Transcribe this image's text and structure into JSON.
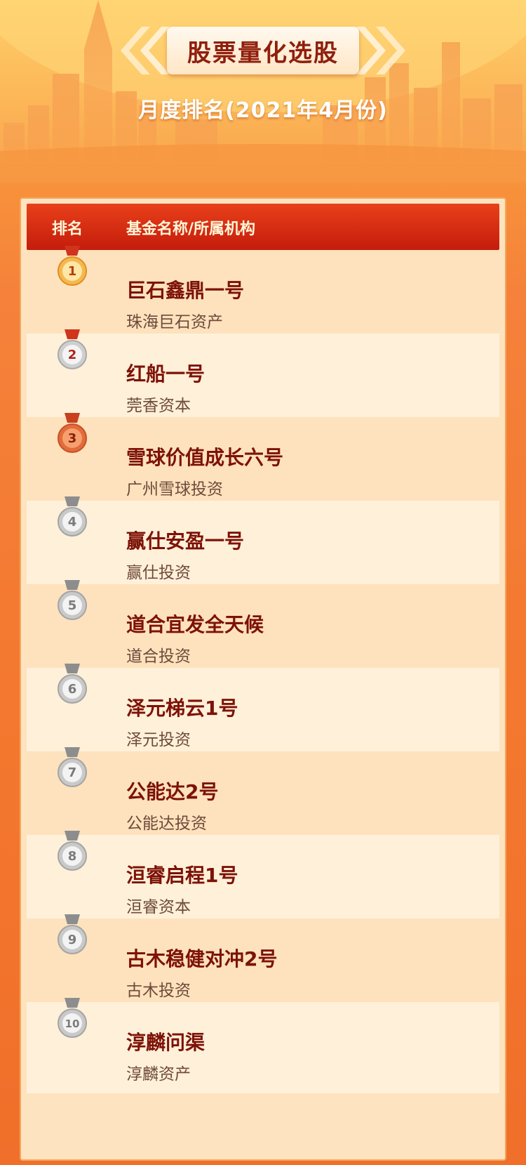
{
  "banner": {
    "title": "股票量化选股"
  },
  "subtitle": "月度排名(2021年4月份)",
  "table": {
    "headers": {
      "rank": "排名",
      "name": "基金名称/所属机构"
    },
    "rows": [
      {
        "rank": "1",
        "medal": "gold",
        "fund": "巨石鑫鼎一号",
        "org": "珠海巨石资产"
      },
      {
        "rank": "2",
        "medal": "silver",
        "fund": "红船一号",
        "org": "莞香资本"
      },
      {
        "rank": "3",
        "medal": "bronze",
        "fund": "雪球价值成长六号",
        "org": "广州雪球投资"
      },
      {
        "rank": "4",
        "medal": "grey",
        "fund": "赢仕安盈一号",
        "org": "赢仕投资"
      },
      {
        "rank": "5",
        "medal": "grey",
        "fund": "道合宜发全天候",
        "org": "道合投资"
      },
      {
        "rank": "6",
        "medal": "grey",
        "fund": "泽元梯云1号",
        "org": "泽元投资"
      },
      {
        "rank": "7",
        "medal": "grey",
        "fund": "公能达2号",
        "org": "公能达投资"
      },
      {
        "rank": "8",
        "medal": "grey",
        "fund": "洹睿启程1号",
        "org": "洹睿资本"
      },
      {
        "rank": "9",
        "medal": "grey",
        "fund": "古木稳健对冲2号",
        "org": "古木投资"
      },
      {
        "rank": "10",
        "medal": "grey",
        "fund": "淳麟问渠",
        "org": "淳麟资产"
      }
    ]
  },
  "colors": {
    "header_red": "#d42a12",
    "fund_text": "#7d1207",
    "org_text": "#6e4a3a",
    "gold": "#f2a437",
    "silver_ribbon": "#d0341c",
    "bronze": "#e2693a",
    "grey": "#a9a9a9"
  }
}
